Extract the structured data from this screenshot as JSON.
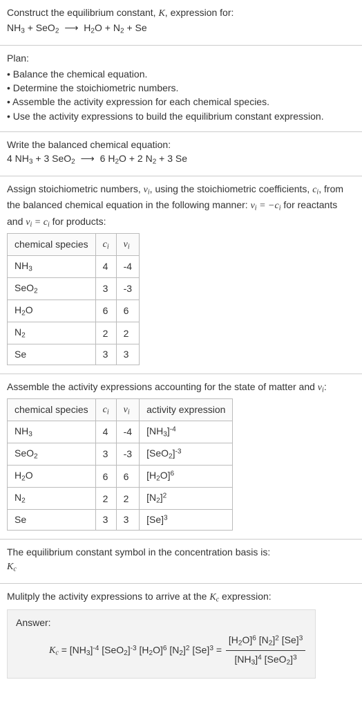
{
  "s1": {
    "title_a": "Construct the equilibrium constant, ",
    "title_b": ", expression for:"
  },
  "plan": {
    "heading": "Plan:",
    "items": [
      "Balance the chemical equation.",
      "Determine the stoichiometric numbers.",
      "Assemble the activity expression for each chemical species.",
      "Use the activity expressions to build the equilibrium constant expression."
    ]
  },
  "s3": {
    "heading": "Write the balanced chemical equation:"
  },
  "s4": {
    "intro_a": "Assign stoichiometric numbers, ",
    "intro_b": ", using the stoichiometric coefficients, ",
    "intro_c": ", from the balanced chemical equation in the following manner: ",
    "intro_d": " for reactants and ",
    "intro_e": " for products:",
    "headers": {
      "h1": "chemical species"
    },
    "rows": [
      {
        "ci": "4",
        "vi": "-4"
      },
      {
        "ci": "3",
        "vi": "-3"
      },
      {
        "ci": "6",
        "vi": "6"
      },
      {
        "ci": "2",
        "vi": "2"
      },
      {
        "ci": "3",
        "vi": "3"
      }
    ]
  },
  "s5": {
    "intro": "Assemble the activity expressions accounting for the state of matter and ",
    "headers": {
      "h1": "chemical species",
      "h4": "activity expression"
    },
    "rows": [
      {
        "ci": "4",
        "vi": "-4"
      },
      {
        "ci": "3",
        "vi": "-3"
      },
      {
        "ci": "6",
        "vi": "6"
      },
      {
        "ci": "2",
        "vi": "2"
      },
      {
        "ci": "3",
        "vi": "3"
      }
    ]
  },
  "s6": {
    "line": "The equilibrium constant symbol in the concentration basis is:"
  },
  "s7": {
    "line": "Mulitply the activity expressions to arrive at the ",
    "line_b": " expression:"
  },
  "answer": {
    "label": "Answer:"
  },
  "labels": {
    "K": "K",
    "Kc": "K",
    "c": "c",
    "vi": "ν",
    "ci": "c",
    "i": "i",
    "eq_neg": " = −",
    "eq_pos": " = "
  },
  "chart_data": {
    "type": "table",
    "tables": [
      {
        "title": "stoichiometric numbers",
        "columns": [
          "chemical species",
          "c_i",
          "ν_i"
        ],
        "rows": [
          [
            "NH3",
            4,
            -4
          ],
          [
            "SeO2",
            3,
            -3
          ],
          [
            "H2O",
            6,
            6
          ],
          [
            "N2",
            2,
            2
          ],
          [
            "Se",
            3,
            3
          ]
        ]
      },
      {
        "title": "activity expressions",
        "columns": [
          "chemical species",
          "c_i",
          "ν_i",
          "activity expression"
        ],
        "rows": [
          [
            "NH3",
            4,
            -4,
            "[NH3]^-4"
          ],
          [
            "SeO2",
            3,
            -3,
            "[SeO2]^-3"
          ],
          [
            "H2O",
            6,
            6,
            "[H2O]^6"
          ],
          [
            "N2",
            2,
            2,
            "[N2]^2"
          ],
          [
            "Se",
            3,
            3,
            "[Se]^3"
          ]
        ]
      }
    ],
    "equations": {
      "unbalanced": "NH3 + SeO2 -> H2O + N2 + Se",
      "balanced": "4 NH3 + 3 SeO2 -> 6 H2O + 2 N2 + 3 Se",
      "Kc": "Kc = [NH3]^-4 [SeO2]^-3 [H2O]^6 [N2]^2 [Se]^3 = ([H2O]^6 [N2]^2 [Se]^3) / ([NH3]^4 [SeO2]^3)"
    }
  }
}
